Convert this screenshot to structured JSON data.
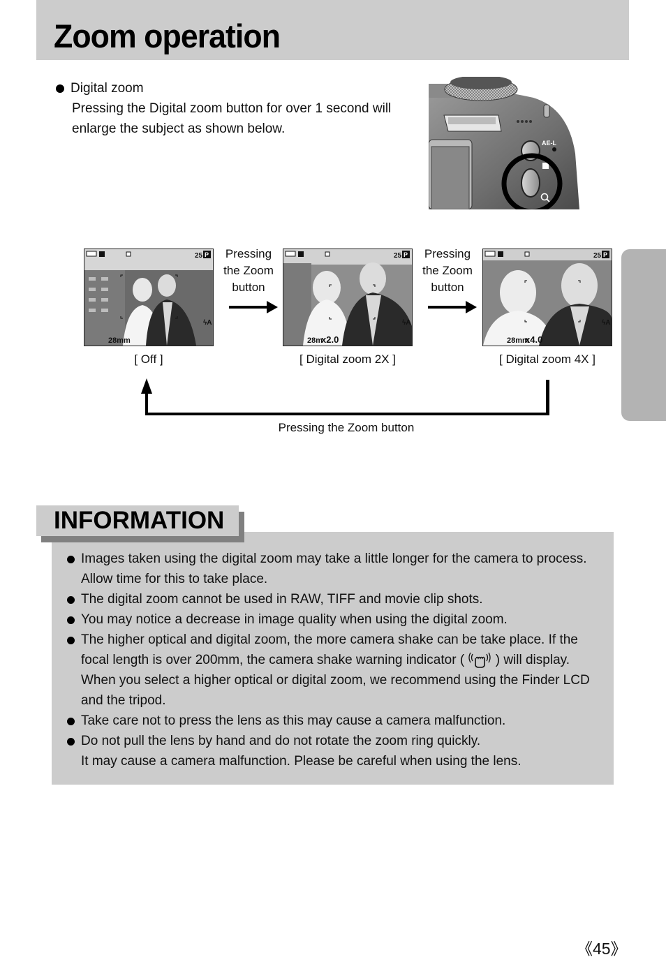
{
  "header": {
    "title": "Zoom operation"
  },
  "intro": {
    "heading": "Digital zoom",
    "lines": [
      "Pressing the Digital zoom button for over 1 second will",
      "enlarge the subject as shown below."
    ]
  },
  "camera_illustration": {
    "button_labels": [
      "AE-L"
    ],
    "highlighted_button": "digital zoom button",
    "magnifier_icon": "magnifier-icon"
  },
  "zoom_flow": {
    "screens": [
      {
        "caption": "[ Off ]",
        "shots_remaining": "25",
        "mode": "P",
        "focal_length": "28mm",
        "zoom_factor": ""
      },
      {
        "caption": "[ Digital zoom 2X ]",
        "shots_remaining": "25",
        "mode": "P",
        "focal_length": "28m",
        "zoom_factor": "x2.0"
      },
      {
        "caption": "[ Digital zoom 4X ]",
        "shots_remaining": "25",
        "mode": "P",
        "focal_length": "28mm",
        "zoom_factor": "x4.0"
      }
    ],
    "step_labels": [
      [
        "Pressing",
        "the Zoom",
        "button"
      ],
      [
        "Pressing",
        "the Zoom",
        "button"
      ]
    ],
    "loop_label": "Pressing the Zoom button"
  },
  "information": {
    "heading": "INFORMATION",
    "items": [
      {
        "lines": [
          "Images taken using the digital zoom may take a little longer for the camera to process.",
          "Allow time for this to take place."
        ]
      },
      {
        "lines": [
          "The digital zoom cannot be used in RAW, TIFF and movie clip shots."
        ]
      },
      {
        "lines": [
          "You may notice a decrease in image quality when using the digital zoom."
        ]
      },
      {
        "lines": [
          "The higher optical and digital zoom, the more camera shake can be take place. If the"
        ],
        "line2_before_icon": "focal length is over 200mm, the camera shake warning indicator (",
        "icon": "camera-shake-warning-icon",
        "line2_after_icon": ") will display.",
        "more_lines": [
          "When you select a higher optical or digital zoom, we recommend using the Finder LCD",
          "and the tripod."
        ]
      },
      {
        "lines": [
          "Take care not to press the lens as this may cause a camera malfunction."
        ]
      },
      {
        "lines": [
          "Do not pull the lens by hand and do not rotate the zoom ring quickly.",
          "It may cause a camera malfunction. Please be careful when using the lens."
        ]
      }
    ]
  },
  "footer": {
    "page_number": "《45》"
  }
}
